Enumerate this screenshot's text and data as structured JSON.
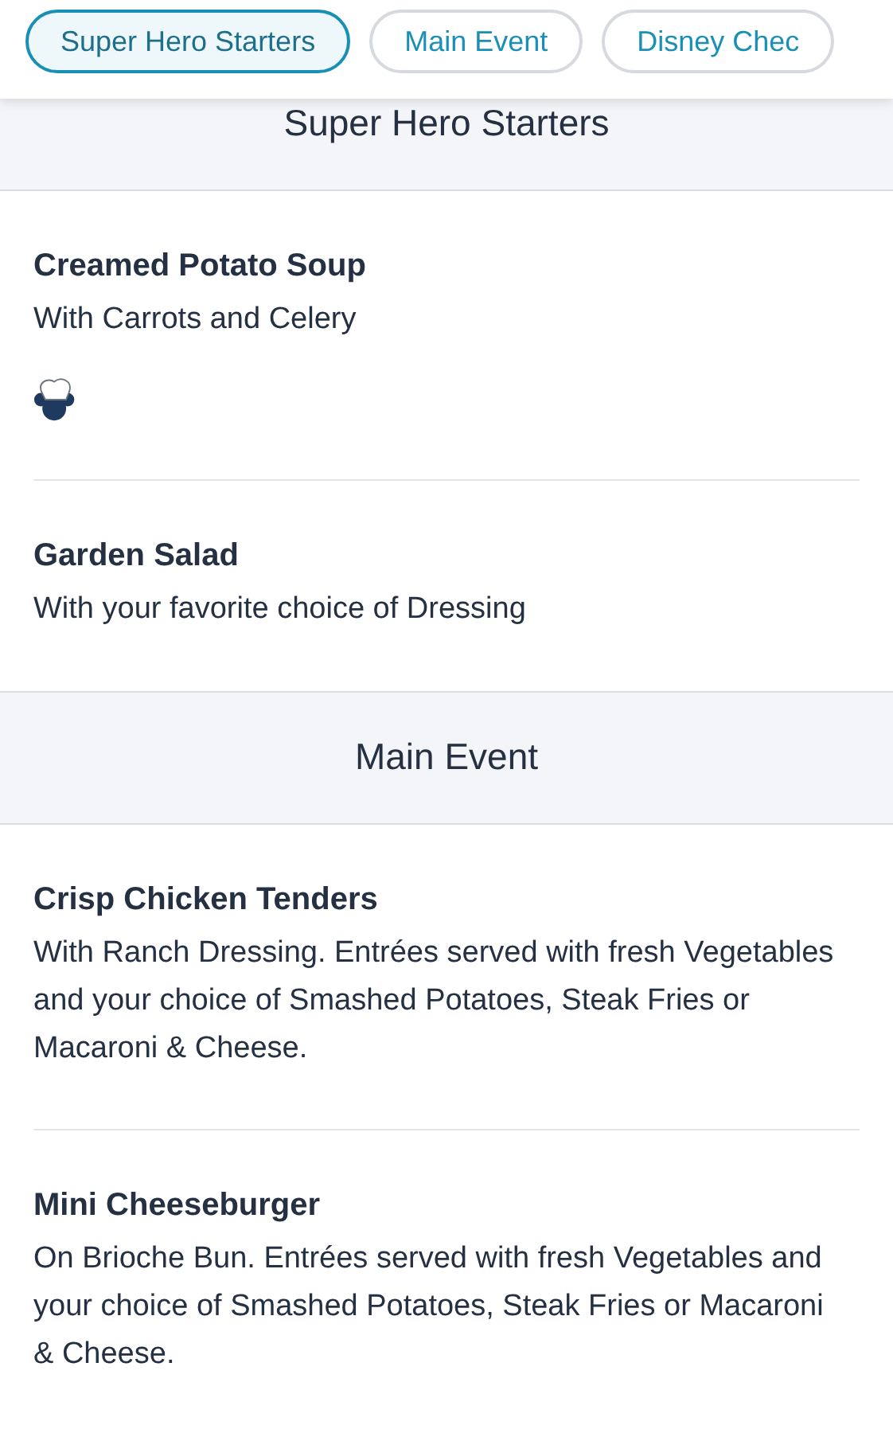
{
  "tabs": [
    {
      "label": "Super Hero Starters",
      "selected": true
    },
    {
      "label": "Main Event",
      "selected": false
    },
    {
      "label": "Disney Chec",
      "selected": false
    }
  ],
  "sections": [
    {
      "title": "Super Hero Starters",
      "items": [
        {
          "name": "Creamed Potato Soup",
          "description": "With Carrots and Celery",
          "chef_icon": true
        },
        {
          "name": "Garden Salad",
          "description": "With your favorite choice of Dressing",
          "chef_icon": false
        }
      ]
    },
    {
      "title": "Main Event",
      "items": [
        {
          "name": "Crisp Chicken Tenders",
          "description": "With Ranch Dressing. Entrées served with fresh Vegetables and your choice of Smashed Potatoes, Steak Fries or Macaroni & Cheese.",
          "chef_icon": false
        },
        {
          "name": "Mini Cheeseburger",
          "description": "On Brioche Bun. Entrées served with fresh Vegetables and your choice of Smashed Potatoes, Steak Fries or Macaroni & Cheese.",
          "chef_icon": false
        }
      ]
    }
  ]
}
